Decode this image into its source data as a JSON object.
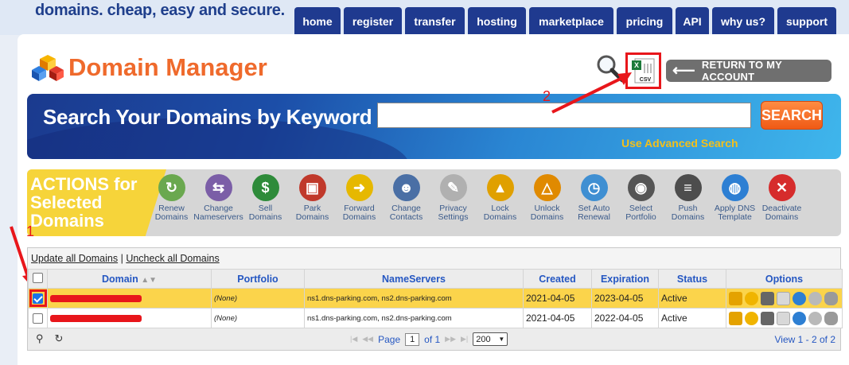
{
  "header": {
    "slogan": "domains. cheap, easy and secure.",
    "nav": [
      "home",
      "register",
      "transfer",
      "hosting",
      "marketplace",
      "pricing",
      "API",
      "why us?",
      "support"
    ]
  },
  "page": {
    "title": "Domain Manager",
    "csv_label": "CSV",
    "return_label": "RETURN TO MY ACCOUNT"
  },
  "search": {
    "label": "Search Your Domains by Keyword",
    "placeholder": "",
    "button": "SEARCH",
    "advanced": "Use Advanced Search"
  },
  "actions": {
    "title_lines": [
      "ACTIONS for",
      "Selected",
      "Domains"
    ],
    "items": [
      {
        "l1": "Renew",
        "l2": "Domains",
        "icon": "renew-icon",
        "color": "#6aa84f"
      },
      {
        "l1": "Change",
        "l2": "Nameservers",
        "icon": "swap-arrows-icon",
        "color": "#7b5ea7"
      },
      {
        "l1": "Sell",
        "l2": "Domains",
        "icon": "dollar-icon",
        "color": "#2e8b3a"
      },
      {
        "l1": "Park",
        "l2": "Domains",
        "icon": "car-icon",
        "color": "#c0392b"
      },
      {
        "l1": "Forward",
        "l2": "Domains",
        "icon": "forward-arrow-icon",
        "color": "#e6b800"
      },
      {
        "l1": "Change",
        "l2": "Contacts",
        "icon": "contacts-icon",
        "color": "#4a6fa5"
      },
      {
        "l1": "Privacy",
        "l2": "Settings",
        "icon": "privacy-tag-icon",
        "color": "#b0b0b0"
      },
      {
        "l1": "Lock",
        "l2": "Domains",
        "icon": "lock-icon",
        "color": "#e0a000"
      },
      {
        "l1": "Unlock",
        "l2": "Domains",
        "icon": "unlock-icon",
        "color": "#e08a00"
      },
      {
        "l1": "Set Auto",
        "l2": "Renewal",
        "icon": "clock-icon",
        "color": "#3f8fd2"
      },
      {
        "l1": "Select",
        "l2": "Portfolio",
        "icon": "gauge-icon",
        "color": "#555555"
      },
      {
        "l1": "Push",
        "l2": "Domains",
        "icon": "servers-icon",
        "color": "#4d4d4d"
      },
      {
        "l1": "Apply DNS",
        "l2": "Template",
        "icon": "globe-icon",
        "color": "#2d7fd3"
      },
      {
        "l1": "Deactivate",
        "l2": "Domains",
        "icon": "close-circle-icon",
        "color": "#d62c2c"
      }
    ]
  },
  "annotations": {
    "one": "1",
    "two": "2"
  },
  "grid": {
    "update_all": "Update all Domains",
    "sep": "|",
    "uncheck_all": "Uncheck all Domains",
    "columns": [
      "Domain",
      "Portfolio",
      "NameServers",
      "Created",
      "Expiration",
      "Status",
      "Options"
    ],
    "rows": [
      {
        "portfolio": "(None)",
        "ns": "ns1.dns-parking.com, ns2.dns-parking.com",
        "created": "2021-04-05",
        "expiration": "2023-04-05",
        "status": "Active",
        "selected": true
      },
      {
        "portfolio": "(None)",
        "ns": "ns1.dns-parking.com, ns2.dns-parking.com",
        "created": "2021-04-05",
        "expiration": "2022-04-05",
        "status": "Active",
        "selected": false
      }
    ],
    "pager": {
      "page_label": "Page",
      "page_value": "1",
      "of_label": "of 1",
      "per_page": "200",
      "view_info": "View 1 - 2 of 2"
    }
  },
  "colors": {
    "brand_orange": "#ef6a2c",
    "nav_blue": "#1f3a8f",
    "highlight_row": "#fbd44b",
    "annotation_red": "#e8161b"
  }
}
